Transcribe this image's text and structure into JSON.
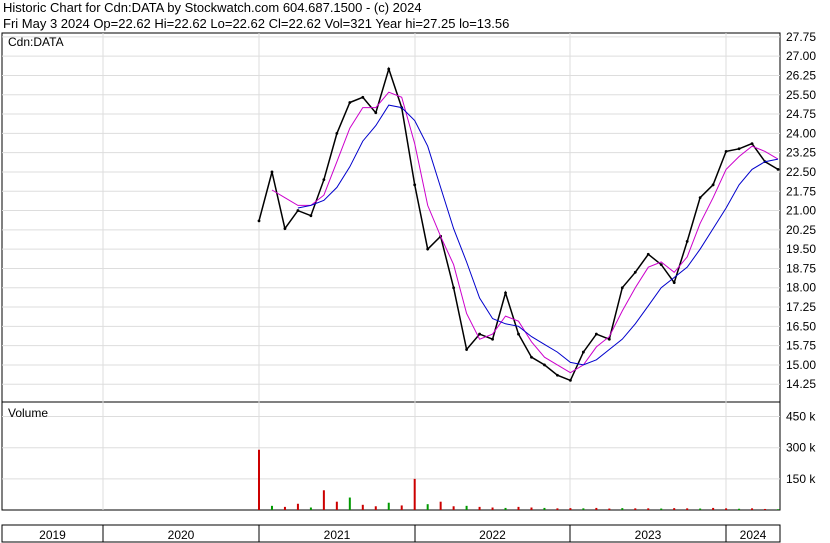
{
  "header": {
    "title": "Historic Chart for Cdn:DATA by Stockwatch.com 604.687.1500 - (c) 2024",
    "quote_line": "Fri May  3 2024   Op=22.62  Hi=22.62  Lo=22.62  Cl=22.62  Vol=321   Year hi=27.25  lo=13.56"
  },
  "price_panel": {
    "label": "Cdn:DATA"
  },
  "volume_panel": {
    "label": "Volume"
  },
  "chart_data": [
    {
      "type": "line",
      "name": "price",
      "ylim": [
        13.56,
        27.9
      ],
      "y_ticks": [
        "27.75",
        "27.00",
        "26.25",
        "25.50",
        "24.75",
        "24.00",
        "23.25",
        "22.50",
        "21.75",
        "21.00",
        "20.25",
        "19.50",
        "18.75",
        "18.00",
        "17.25",
        "16.50",
        "15.75",
        "15.00",
        "14.25"
      ],
      "x_years": [
        "2019",
        "2020",
        "2021",
        "2022",
        "2023",
        "2024"
      ],
      "x": [
        "2021-01",
        "2021-02",
        "2021-03",
        "2021-04",
        "2021-05",
        "2021-06",
        "2021-07",
        "2021-08",
        "2021-09",
        "2021-10",
        "2021-11",
        "2021-12",
        "2022-01",
        "2022-02",
        "2022-03",
        "2022-04",
        "2022-05",
        "2022-06",
        "2022-07",
        "2022-08",
        "2022-09",
        "2022-10",
        "2022-11",
        "2022-12",
        "2023-01",
        "2023-02",
        "2023-03",
        "2023-04",
        "2023-05",
        "2023-06",
        "2023-07",
        "2023-08",
        "2023-09",
        "2023-10",
        "2023-11",
        "2023-12",
        "2024-01",
        "2024-02",
        "2024-03",
        "2024-04",
        "2024-05"
      ],
      "series": [
        {
          "values": [
            20.6,
            22.5,
            20.3,
            21.0,
            20.8,
            22.2,
            24.0,
            25.2,
            25.4,
            24.8,
            26.5,
            25.0,
            22.0,
            19.5,
            20.0,
            18.0,
            15.6,
            16.2,
            16.0,
            17.8,
            16.2,
            15.3,
            15.0,
            14.6,
            14.4,
            15.5,
            16.2,
            16.0,
            18.0,
            18.6,
            19.3,
            18.9,
            18.2,
            19.8,
            21.5,
            22.0,
            23.3,
            23.4,
            23.6,
            22.9,
            22.6
          ],
          "color": "#000000"
        },
        {
          "values": [
            null,
            21.8,
            21.5,
            21.2,
            21.2,
            21.6,
            22.9,
            24.2,
            25.0,
            25.0,
            25.6,
            25.4,
            23.6,
            21.2,
            20.0,
            18.9,
            17.0,
            16.0,
            16.2,
            16.9,
            16.7,
            15.9,
            15.3,
            15.0,
            14.7,
            15.0,
            15.7,
            16.1,
            17.1,
            18.0,
            18.8,
            19.0,
            18.6,
            19.2,
            20.5,
            21.5,
            22.6,
            23.1,
            23.5,
            23.3,
            23.0
          ],
          "color": "#cc00cc"
        },
        {
          "values": [
            null,
            null,
            null,
            21.1,
            21.2,
            21.4,
            21.9,
            22.7,
            23.7,
            24.3,
            25.1,
            25.0,
            24.5,
            23.5,
            21.9,
            20.3,
            19.0,
            17.6,
            16.8,
            16.6,
            16.5,
            16.1,
            15.8,
            15.5,
            15.1,
            15.0,
            15.2,
            15.6,
            16.0,
            16.6,
            17.3,
            18.0,
            18.4,
            18.8,
            19.5,
            20.3,
            21.1,
            22.0,
            22.6,
            22.9,
            23.0
          ],
          "color": "#0000cc"
        }
      ],
      "grid": true
    },
    {
      "type": "bar",
      "name": "volume",
      "ylim": [
        0,
        520
      ],
      "y_ticks": [
        "450 k",
        "300 k",
        "150 k"
      ],
      "values": [
        290,
        20,
        15,
        30,
        12,
        95,
        40,
        60,
        25,
        18,
        35,
        22,
        150,
        28,
        40,
        18,
        20,
        15,
        12,
        10,
        15,
        12,
        10,
        8,
        9,
        8,
        10,
        7,
        9,
        8,
        8,
        7,
        9,
        8,
        7,
        10,
        8,
        6,
        8,
        5,
        4
      ]
    }
  ]
}
